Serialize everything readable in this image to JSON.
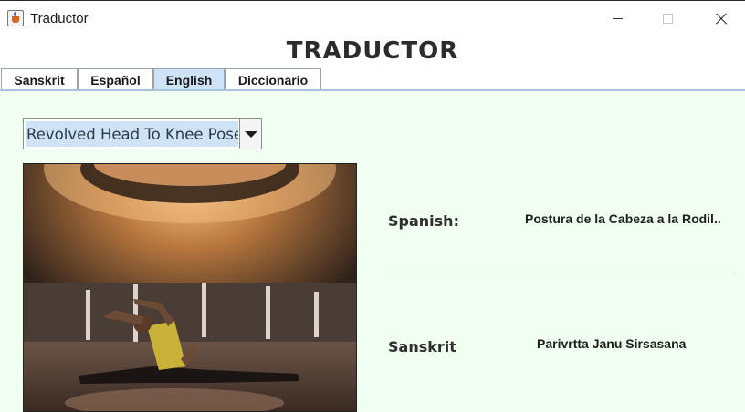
{
  "window": {
    "title": "Traductor"
  },
  "heading": "TRADUCTOR",
  "tabs": [
    {
      "label": "Sanskrit",
      "active": false
    },
    {
      "label": "Español",
      "active": false
    },
    {
      "label": "English",
      "active": true
    },
    {
      "label": "Diccionario",
      "active": false
    }
  ],
  "pose_select": {
    "selected": "Revolved Head To Knee Pose"
  },
  "translations": {
    "spanish": {
      "label": "Spanish:",
      "value": "Postura de la Cabeza a la Rodil.."
    },
    "sanskrit": {
      "label": "Sanskrit",
      "value": "Parivrtta Janu Sirsasana"
    }
  },
  "colors": {
    "panel_bg": "#f0fff0",
    "selection": "#cfe3f7",
    "active_tab": "#cfe3f7"
  },
  "icons": [
    "java-app-icon",
    "minimize-icon",
    "maximize-icon",
    "close-icon",
    "dropdown-arrow-icon"
  ]
}
